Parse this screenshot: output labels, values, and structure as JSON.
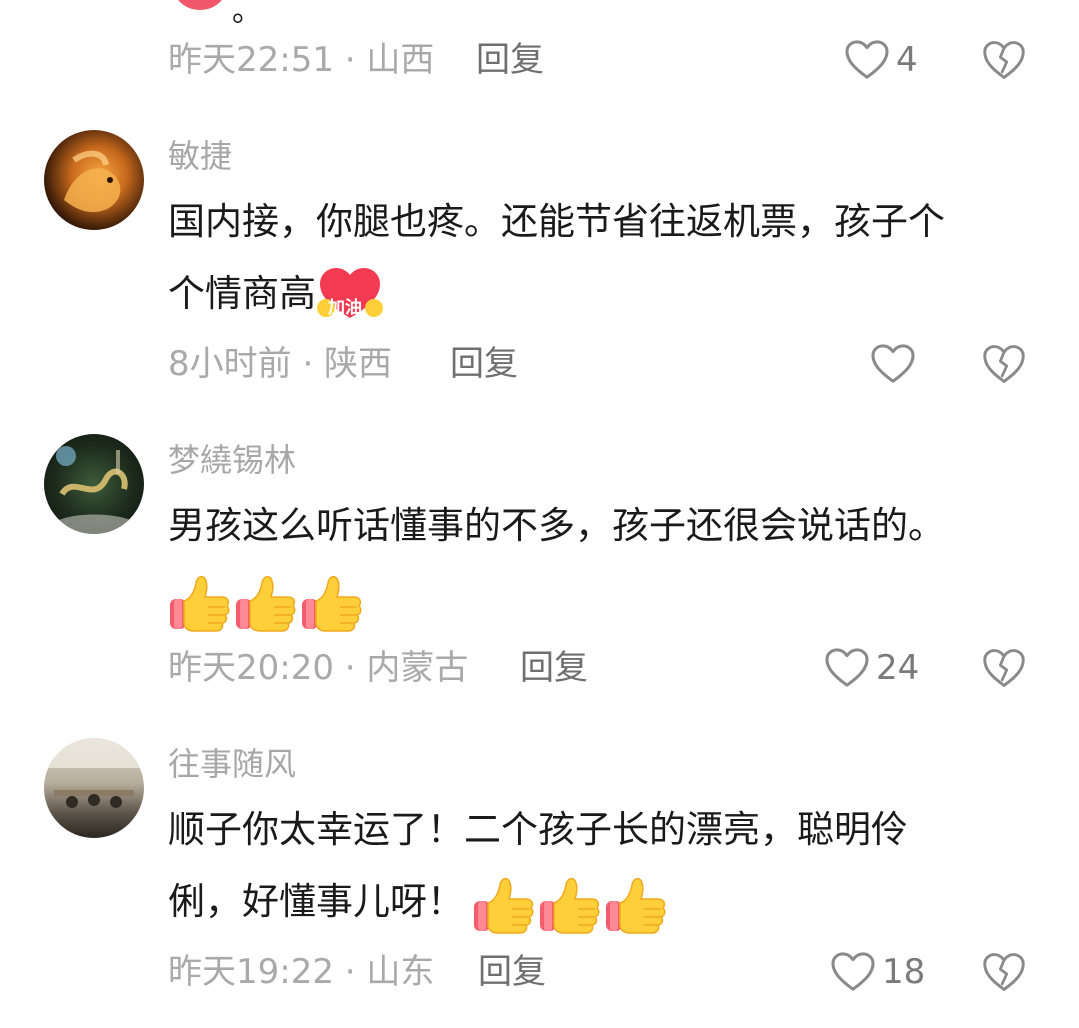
{
  "colors": {
    "meta": "#a9a9a9",
    "reply": "#6f6f6f",
    "text": "#1a1a1a",
    "heart_outline": "#8a8a8a",
    "thumb_yellow": "#ffcf3a",
    "thumb_cuff": "#f45b6b",
    "sticker_red": "#f23b52"
  },
  "top_partial": {
    "meta": "昨天22:51 · 山西",
    "reply": "回复",
    "likes": "4"
  },
  "comments": [
    {
      "username": "敏捷",
      "text_line1": "国内接，你腿也疼。还能节省往返机票，孩子个",
      "text_line2": "个情商高",
      "sticker_text": "加油",
      "meta": "8小时前 · 陕西",
      "reply": "回复",
      "likes": ""
    },
    {
      "username": "梦繞锡林",
      "text_line1": "男孩这么听话懂事的不多，孩子还很会说话的。",
      "emoji": [
        "thumbs-up",
        "thumbs-up",
        "thumbs-up"
      ],
      "meta": "昨天20:20 · 内蒙古",
      "reply": "回复",
      "likes": "24"
    },
    {
      "username": "往事随风",
      "text_line1": "顺子你太幸运了！二个孩子长的漂亮，聪明伶",
      "text_line2": "俐，好懂事儿呀！",
      "emoji": [
        "thumbs-up",
        "thumbs-up",
        "thumbs-up"
      ],
      "meta": "昨天19:22 · 山东",
      "reply": "回复",
      "likes": "18"
    }
  ],
  "icons": {
    "like": "heart-outline-icon",
    "dislike": "broken-heart-icon",
    "reaction": "thumbs-up-emoji"
  }
}
